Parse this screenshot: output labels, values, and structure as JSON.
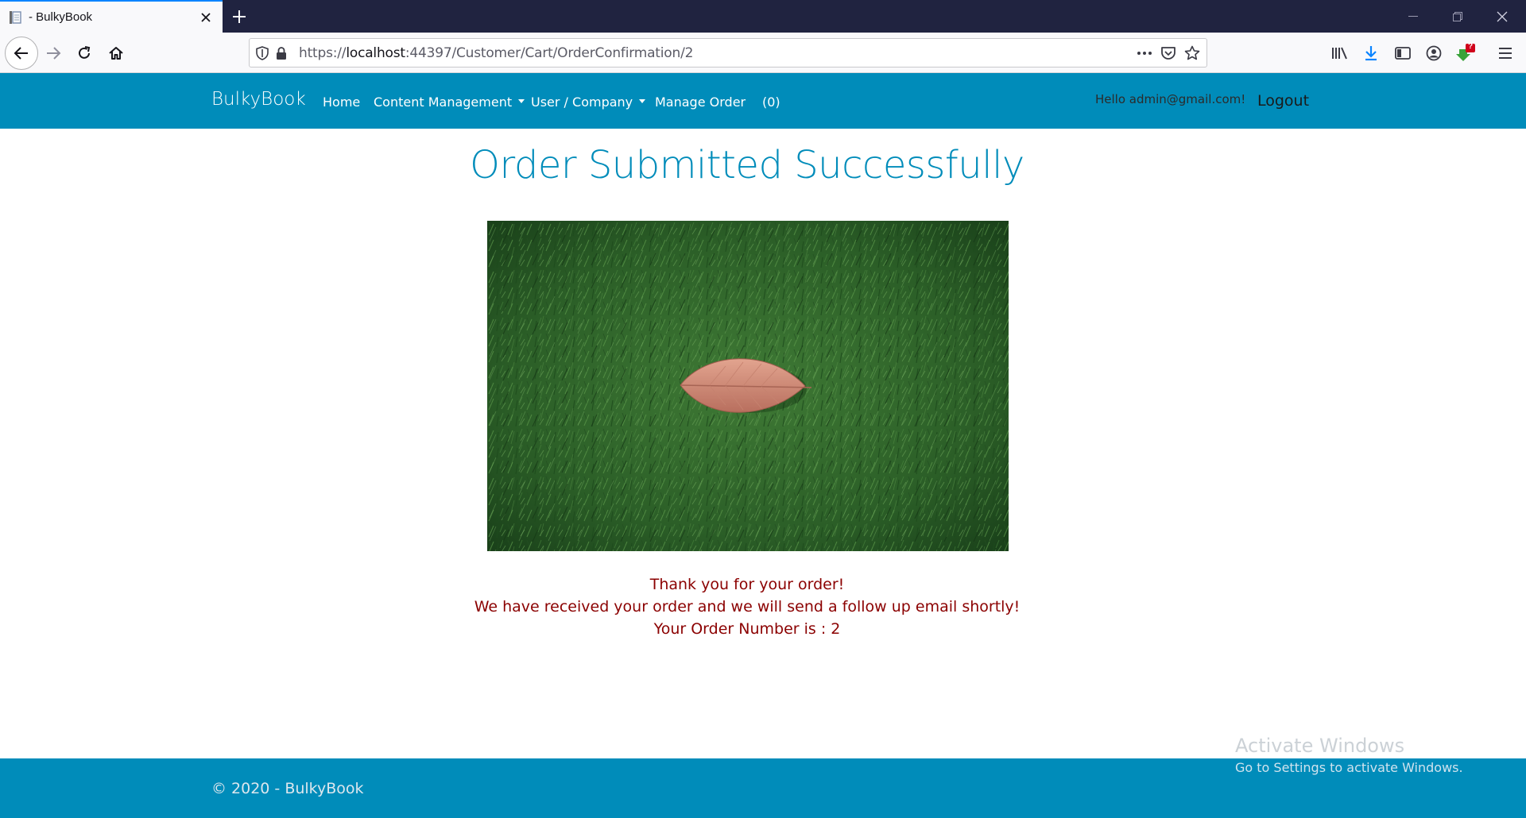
{
  "browser": {
    "tab_title": "- BulkyBook",
    "url_prefix": "https://",
    "url_host": "localhost",
    "url_path": ":44397/Customer/Cart/OrderConfirmation/2",
    "badge": "?"
  },
  "site_nav": {
    "brand": "BulkyBook",
    "links": [
      {
        "label": "Home"
      },
      {
        "label": "Content Management"
      },
      {
        "label": "User / Company"
      },
      {
        "label": "Manage Order"
      },
      {
        "label": "(0)"
      }
    ],
    "greeting": "Hello admin@gmail.com!",
    "logout": "Logout"
  },
  "main": {
    "title": "Order Submitted Successfully",
    "thank_you": "Thank you for your order!",
    "received": "We have received your order and we will send a follow up email shortly!",
    "order_number": "Your Order Number is : 2"
  },
  "footer": {
    "copyright": "© 2020 - BulkyBook"
  },
  "watermark": {
    "line1": "Activate Windows",
    "line2": "Go to Settings to activate Windows."
  },
  "colors": {
    "primary": "#008cba",
    "message": "#8b0000",
    "tabstrip": "#202340"
  }
}
